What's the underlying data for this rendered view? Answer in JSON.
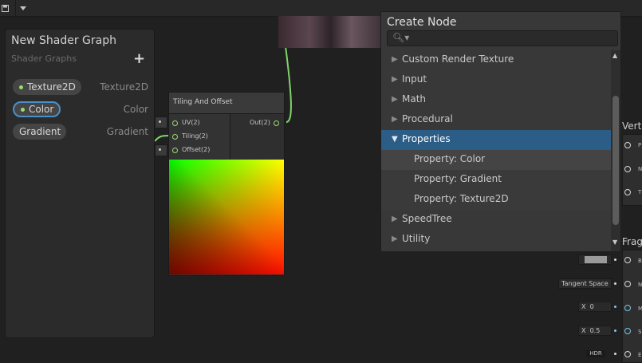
{
  "toolbar": {
    "save_icon": "save-icon",
    "dropdown_icon": "chevron-down-icon"
  },
  "blackboard": {
    "title": "New Shader Graph",
    "subtitle": "Shader Graphs",
    "add_label": "+",
    "properties": [
      {
        "name": "Texture2D",
        "type": "Texture2D",
        "selected": false
      },
      {
        "name": "Color",
        "type": "Color",
        "selected": true
      },
      {
        "name": "Gradient",
        "type": "Gradient",
        "selected": false
      }
    ]
  },
  "node": {
    "title": "Tiling And Offset",
    "inputs": [
      "UV(2)",
      "Tiling(2)",
      "Offset(2)"
    ],
    "output": "Out(2)"
  },
  "create_node": {
    "title": "Create Node",
    "search_placeholder": "",
    "items": [
      {
        "label": "Custom Render Texture",
        "expanded": false
      },
      {
        "label": "Input",
        "expanded": false
      },
      {
        "label": "Math",
        "expanded": false
      },
      {
        "label": "Procedural",
        "expanded": false
      },
      {
        "label": "Properties",
        "expanded": true,
        "selected": true
      },
      {
        "label": "Property: Color",
        "sub": true,
        "highlight": true
      },
      {
        "label": "Property: Gradient",
        "sub": true
      },
      {
        "label": "Property: Texture2D",
        "sub": true
      },
      {
        "label": "SpeedTree",
        "expanded": false
      },
      {
        "label": "Utility",
        "expanded": false
      }
    ]
  },
  "stack": {
    "vertex_title": "Verte",
    "fragment_title": "Frag",
    "vertex_ports": [
      "P",
      "N",
      "T"
    ],
    "fragment_ports": [
      "B",
      "N",
      "M",
      "S",
      "E"
    ],
    "tangent_space": "Tangent Space",
    "metallic_x": "X",
    "metallic_value": "0",
    "smooth_x": "X",
    "smooth_value": "0.5",
    "hdr": "HDR"
  },
  "colors": {
    "accent": "#2c5d87",
    "port": "#9bdc6e",
    "selection_border": "#4a90c8"
  }
}
